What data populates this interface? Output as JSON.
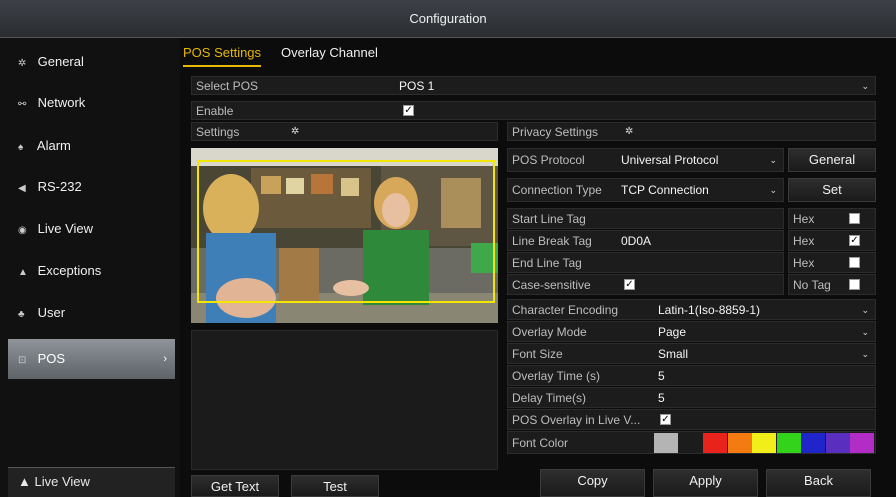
{
  "window": {
    "title": "Configuration"
  },
  "sidebar": {
    "items": [
      {
        "label": "General",
        "icon": "gear-icon"
      },
      {
        "label": "Network",
        "icon": "network-icon"
      },
      {
        "label": "Alarm",
        "icon": "alarm-icon"
      },
      {
        "label": "RS-232",
        "icon": "serial-port-icon"
      },
      {
        "label": "Live View",
        "icon": "eye-icon"
      },
      {
        "label": "Exceptions",
        "icon": "warning-icon"
      },
      {
        "label": "User",
        "icon": "user-icon"
      },
      {
        "label": "POS",
        "icon": "pos-terminal-icon",
        "active": true
      }
    ],
    "bottom_label": "Live View"
  },
  "tabs": [
    {
      "label": "POS Settings",
      "active": true
    },
    {
      "label": "Overlay Channel",
      "active": false
    }
  ],
  "form": {
    "select_pos": {
      "label": "Select POS",
      "value": "POS 1"
    },
    "enable": {
      "label": "Enable",
      "checked": true
    },
    "settings": {
      "label": "Settings"
    },
    "privacy_settings": {
      "label": "Privacy Settings"
    },
    "pos_protocol": {
      "label": "POS Protocol",
      "value": "Universal Protocol",
      "button": "General"
    },
    "connection_type": {
      "label": "Connection Type",
      "value": "TCP Connection",
      "button": "Set"
    },
    "start_line_tag": {
      "label": "Start Line Tag",
      "value": "",
      "hex_label": "Hex",
      "hex_checked": false
    },
    "line_break_tag": {
      "label": "Line Break Tag",
      "value": "0D0A",
      "hex_label": "Hex",
      "hex_checked": true
    },
    "end_line_tag": {
      "label": "End Line Tag",
      "value": "",
      "hex_label": "Hex",
      "hex_checked": false
    },
    "case_sensitive": {
      "label": "Case-sensitive",
      "checked": true,
      "notag_label": "No Tag",
      "notag_checked": false
    },
    "character_encoding": {
      "label": "Character Encoding",
      "value": "Latin-1(Iso-8859-1)"
    },
    "overlay_mode": {
      "label": "Overlay Mode",
      "value": "Page"
    },
    "font_size": {
      "label": "Font Size",
      "value": "Small"
    },
    "overlay_time": {
      "label": "Overlay Time (s)",
      "value": "5"
    },
    "delay_time": {
      "label": "Delay Time(s)",
      "value": "5"
    },
    "pos_overlay_live": {
      "label": "POS Overlay in Live V...",
      "checked": true
    },
    "font_color": {
      "label": "Font Color",
      "selected": "#b4b4b4",
      "palette": [
        "#e8231c",
        "#f47a12",
        "#f1ee1a",
        "#33d21b",
        "#2025c9",
        "#5a2fbf",
        "#b12dc6"
      ]
    }
  },
  "buttons": {
    "get_text": "Get Text",
    "test": "Test",
    "copy": "Copy",
    "apply": "Apply",
    "back": "Back"
  },
  "colors": {
    "accent": "#e6b800",
    "roi_box": "#f3e600"
  }
}
